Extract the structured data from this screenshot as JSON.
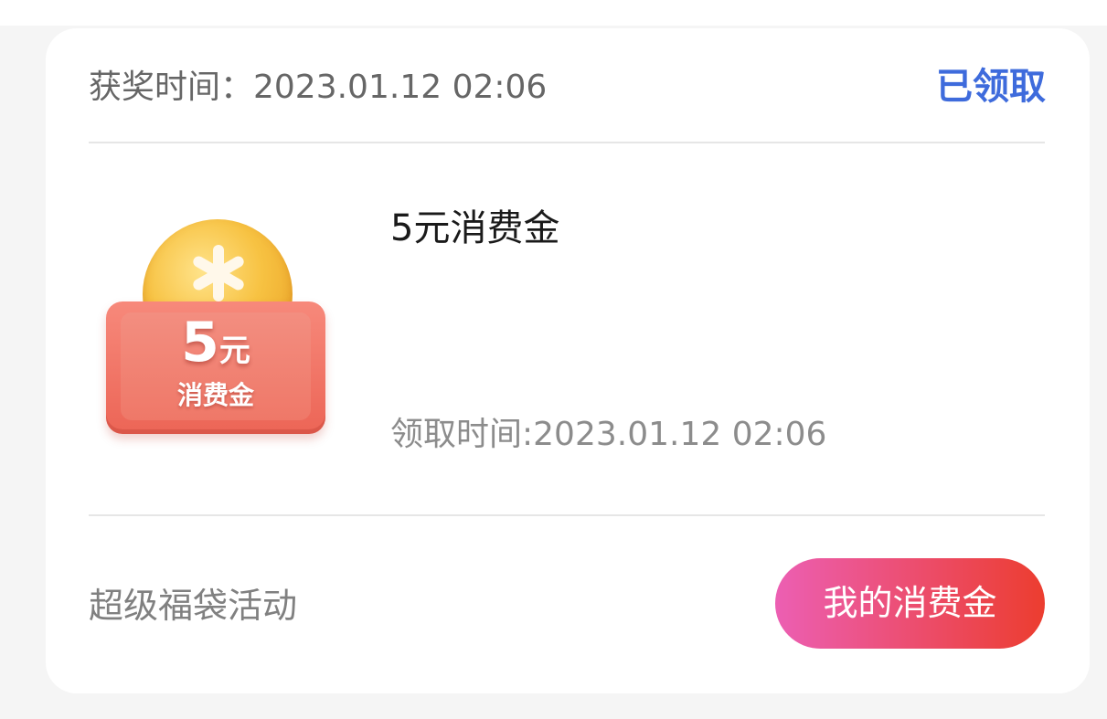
{
  "header": {
    "award_time_label": "获奖时间：2023.01.12 02:06",
    "status": "已领取"
  },
  "reward": {
    "image": {
      "amount": "5",
      "unit": "元",
      "name": "消费金",
      "icon": "coin-wallet-icon"
    },
    "title": "5元消费金",
    "claim_time": "领取时间:2023.01.12 02:06"
  },
  "footer": {
    "activity_name": "超级福袋活动",
    "button_label": "我的消费金"
  },
  "colors": {
    "status_blue": "#3e6bdc",
    "button_gradient_start": "#ec5fb3",
    "button_gradient_end": "#ec3d2f",
    "wallet_red": "#ec6556",
    "coin_gold": "#f7c242"
  }
}
